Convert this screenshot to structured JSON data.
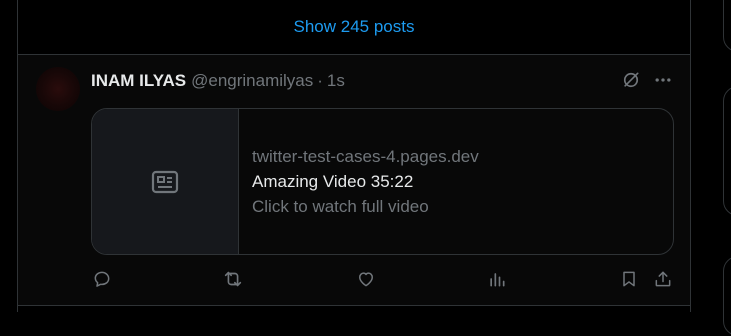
{
  "timeline": {
    "show_posts_label": "Show 245 posts"
  },
  "post": {
    "author": {
      "display_name": "INAM ILYAS",
      "handle": "@engrinamilyas",
      "separator": "·",
      "time": "1s"
    },
    "header_icons": [
      "grok-icon",
      "more-icon"
    ],
    "card": {
      "thumbnail_icon": "article-icon",
      "domain": "twitter-test-cases-4.pages.dev",
      "title": "Amazing Video 35:22",
      "description": "Click to watch full video"
    },
    "actions": [
      "reply-icon",
      "repost-icon",
      "like-icon",
      "views-icon",
      "bookmark-icon",
      "share-icon"
    ]
  },
  "colors": {
    "background": "#000000",
    "post_background": "#080808",
    "border": "#2f3336",
    "accent": "#1d9bf0",
    "primary_text": "#e7e9ea",
    "secondary_text": "#71767b"
  }
}
